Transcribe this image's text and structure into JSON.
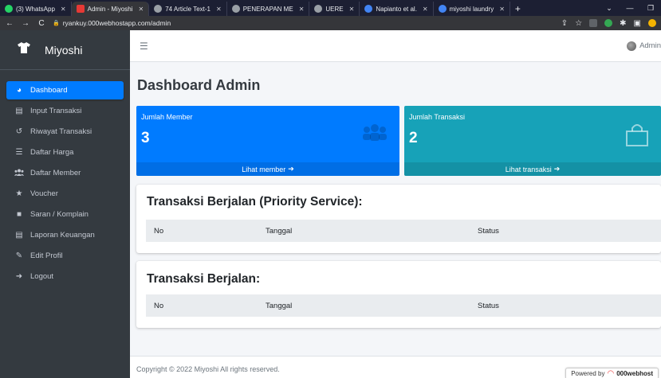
{
  "browser": {
    "tabs": [
      {
        "label": "(3) WhatsApp",
        "color": "#25d366"
      },
      {
        "label": "Admin - Miyoshi",
        "color": "#e53935"
      },
      {
        "label": "74 Article Text-1",
        "color": "#9aa0a6"
      },
      {
        "label": "PENERAPAN ME",
        "color": "#9aa0a6"
      },
      {
        "label": "UERE",
        "color": "#9aa0a6"
      },
      {
        "label": "Napianto et al.",
        "color": "#4285f4"
      },
      {
        "label": "miyoshi laundry",
        "color": "#4285f4"
      }
    ],
    "url": "ryankuy.000webhostapp.com/admin"
  },
  "sidebar": {
    "brand": "Miyoshi",
    "items": [
      {
        "label": "Dashboard",
        "icon": "tachometer-icon",
        "glyph": "◕"
      },
      {
        "label": "Input Transaksi",
        "icon": "file-icon",
        "glyph": "▤"
      },
      {
        "label": "Riwayat Transaksi",
        "icon": "history-icon",
        "glyph": "↺"
      },
      {
        "label": "Daftar Harga",
        "icon": "list-icon",
        "glyph": "☰"
      },
      {
        "label": "Daftar Member",
        "icon": "users-icon",
        "glyph": "👥"
      },
      {
        "label": "Voucher",
        "icon": "star-icon",
        "glyph": "★"
      },
      {
        "label": "Saran / Komplain",
        "icon": "comment-icon",
        "glyph": "■"
      },
      {
        "label": "Laporan Keuangan",
        "icon": "file-text-icon",
        "glyph": "▤"
      },
      {
        "label": "Edit Profil",
        "icon": "user-edit-icon",
        "glyph": "✎"
      },
      {
        "label": "Logout",
        "icon": "sign-out-icon",
        "glyph": "➜"
      }
    ]
  },
  "navbar": {
    "user": "Admin"
  },
  "page": {
    "title": "Dashboard Admin"
  },
  "boxes": {
    "member": {
      "label": "Jumlah Member",
      "value": "3",
      "link": "Lihat member"
    },
    "transaksi": {
      "label": "Jumlah Transaksi",
      "value": "2",
      "link": "Lihat transaksi"
    }
  },
  "tables": {
    "priority": {
      "title": "Transaksi Berjalan (Priority Service):",
      "columns": [
        "No",
        "Tanggal",
        "Status"
      ]
    },
    "regular": {
      "title": "Transaksi Berjalan:",
      "columns": [
        "No",
        "Tanggal",
        "Status"
      ]
    }
  },
  "footer": {
    "copyright": "Copyright © 2022 Miyoshi All rights reserved.",
    "powered_prefix": "Powered by",
    "powered_host": "000webhost"
  },
  "colors": {
    "primary": "#007bff",
    "info": "#17a2b8",
    "sidebar": "#343a40"
  }
}
